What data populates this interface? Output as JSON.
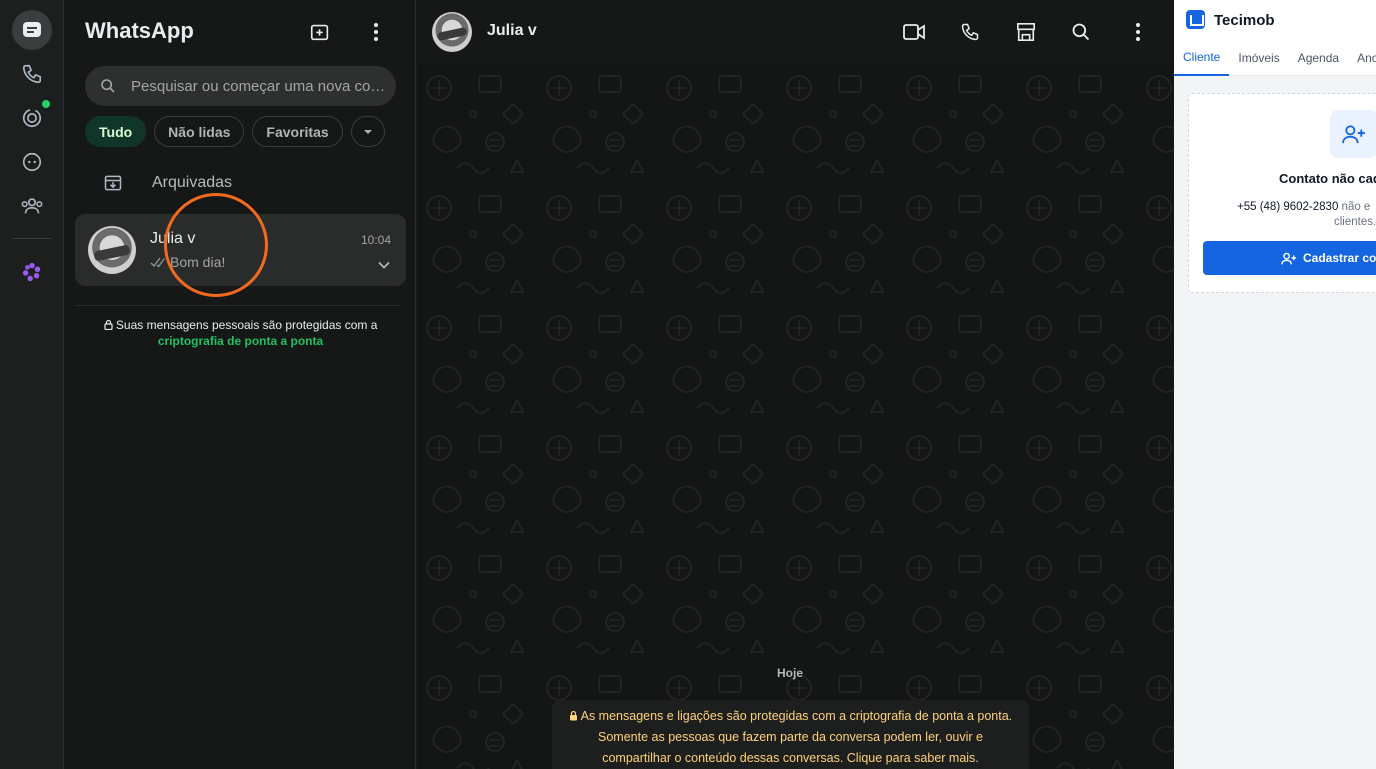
{
  "rail": {
    "items": [
      {
        "icon": "chats-icon",
        "active": true
      },
      {
        "icon": "calls-icon"
      },
      {
        "icon": "status-icon",
        "badge": true
      },
      {
        "icon": "channels-icon"
      },
      {
        "icon": "communities-icon"
      },
      {
        "icon": "meta-ai-icon"
      }
    ]
  },
  "sidebar": {
    "title": "WhatsApp",
    "search_placeholder": "Pesquisar ou começar uma nova conversa",
    "filters": [
      "Tudo",
      "Não lidas",
      "Favoritas"
    ],
    "archived_label": "Arquivadas",
    "chats": [
      {
        "name": "Julia v",
        "time": "10:04",
        "preview": "Bom dia!"
      }
    ],
    "e2e_text": "Suas mensagens pessoais são protegidas com a",
    "e2e_link": "criptografia de ponta a ponta"
  },
  "conversation": {
    "contact_name": "Julia v",
    "date_label": "Hoje",
    "system_message": "As mensagens e ligações são protegidas com a criptografia de ponta a ponta. Somente as pessoas que fazem parte da conversa podem ler, ouvir e compartilhar o conteúdo dessas conversas. Clique para saber mais."
  },
  "panel": {
    "title": "Tecimob",
    "tabs": [
      "Cliente",
      "Imóveis",
      "Agenda",
      "Anota"
    ],
    "card_title": "Contato não cad",
    "card_phone": "+55 (48) 9602-2830",
    "card_phone_suffix": "não e",
    "card_sub": "clientes.",
    "card_button": "Cadastrar con"
  },
  "colors": {
    "accent": "#21c063",
    "annotation": "#f26b1d",
    "panel_accent": "#1565e0"
  }
}
